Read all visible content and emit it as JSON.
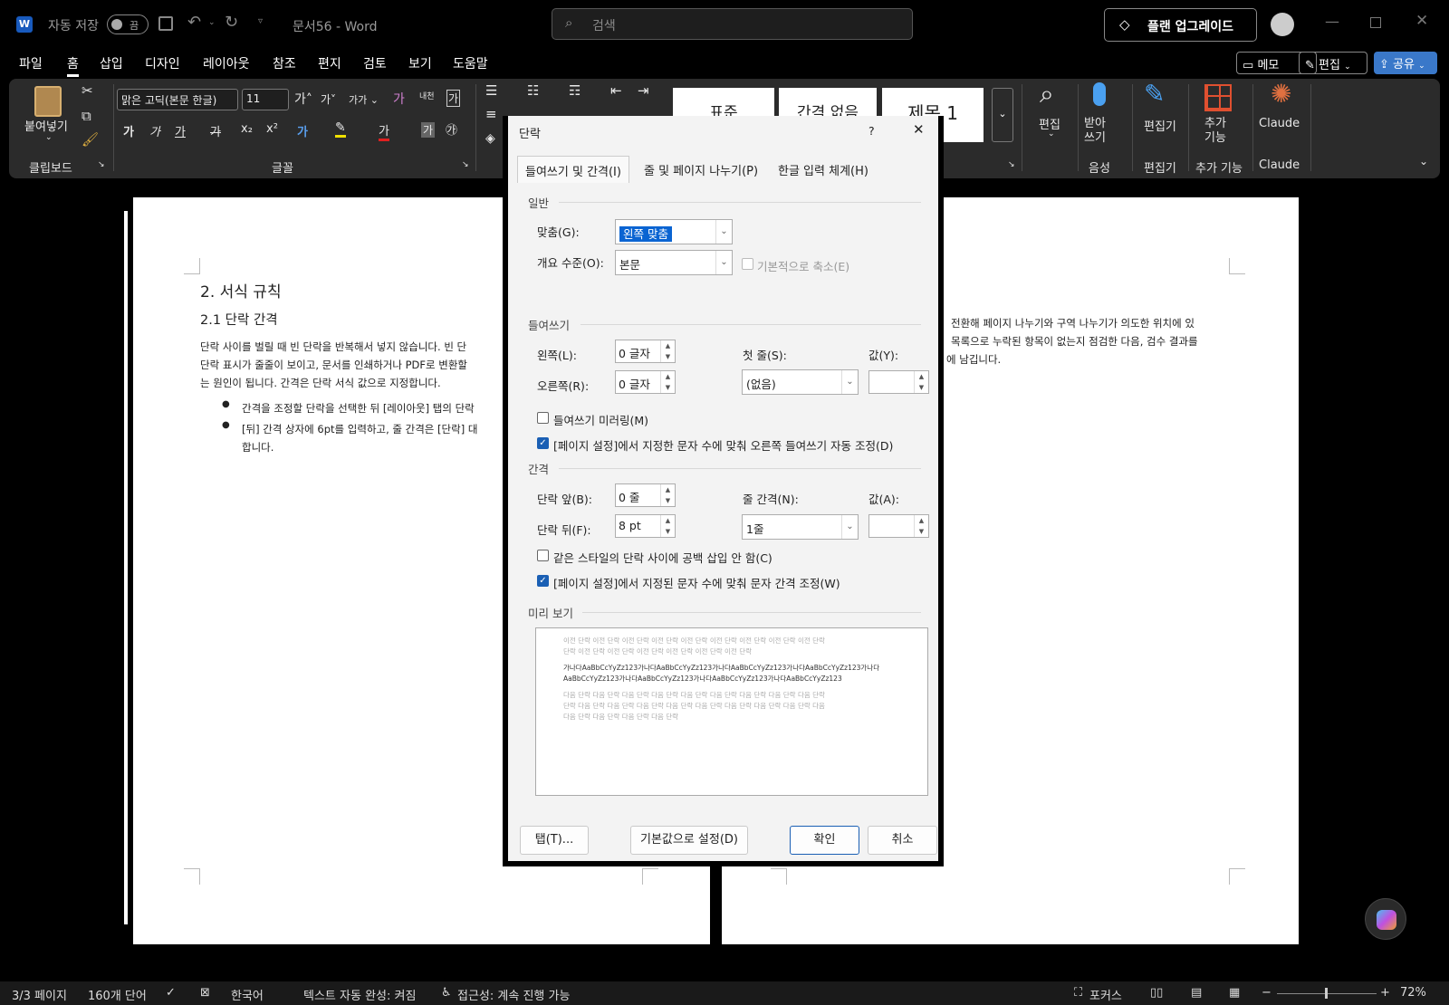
{
  "titlebar": {
    "autosave_label": "자동 저장",
    "autosave_state": "끔",
    "doc_title": "문서56 - Word",
    "search_placeholder": "검색",
    "upgrade_label": "플랜 업그레이드"
  },
  "tabs": [
    "파일",
    "홈",
    "삽입",
    "디자인",
    "레이아웃",
    "참조",
    "편지",
    "검토",
    "보기",
    "도움말"
  ],
  "right_buttons": {
    "memo": "메모",
    "edit": "편집",
    "share": "공유"
  },
  "ribbon": {
    "paste": "붙여넣기",
    "clipboard": "클립보드",
    "font_name": "맑은 고딕(본문 한글)",
    "font_size": "11",
    "font_group": "글꼴",
    "styles": [
      "표준",
      "간격 없음",
      "제목 1"
    ],
    "edit": "편집",
    "dictate": "받아\n쓰기",
    "voice": "음성",
    "editor": "편집기",
    "editor_group": "편집기",
    "addins": "추가\n기능",
    "addins_group": "추가 기능",
    "claude": "Claude",
    "claude_group": "Claude",
    "font_buttons": [
      "가",
      "가",
      "가",
      "가",
      "x₂",
      "x²",
      "가",
      "가"
    ]
  },
  "doc": {
    "h2": "2. 서식 규칙",
    "h3": "2.1 단락 간격",
    "para1": "단락 사이를 벌릴 때 빈 단락을 반복해서 넣지 않습니다. 빈 단",
    "para2": "단락 표시가 줄줄이 보이고, 문서를 인쇄하거나 PDF로 변환할",
    "para3": "는 원인이 됩니다. 간격은 단락 서식 값으로 지정합니다.",
    "bullet1": "간격을 조정할 단락을 선택한 뒤 [레이아웃] 탭의 단락",
    "bullet2a": "[뒤] 간격 상자에 6pt를 입력하고, 줄 간격은 [단락] 대",
    "bullet2b": "합니다.",
    "right1": "전환해 페이지 나누기와 구역 나누기가 의도한 위치에 있",
    "right2": "목록으로 누락된 항목이 없는지 점검한 다음, 검수 결과를",
    "right3": "에 남깁니다."
  },
  "dialog": {
    "title": "단락",
    "help": "?",
    "tabs": [
      "들여쓰기 및 간격(I)",
      "줄 및 페이지 나누기(P)",
      "한글 입력 체계(H)"
    ],
    "general": "일반",
    "align_label": "맞춤(G):",
    "align_value": "왼쪽 맞춤",
    "outline_label": "개요 수준(O):",
    "outline_value": "본문",
    "collapse_label": "기본적으로 축소(E)",
    "indent": "들여쓰기",
    "left_label": "왼쪽(L):",
    "left_value": "0 글자",
    "right_label": "오른쪽(R):",
    "right_value": "0 글자",
    "first_label": "첫 줄(S):",
    "first_value": "(없음)",
    "val_label": "값(Y):",
    "mirror_label": "들여쓰기 미러링(M)",
    "auto_right_label": "[페이지 설정]에서 지정한 문자 수에 맞춰 오른쪽 들여쓰기 자동 조정(D)",
    "spacing": "간격",
    "before_label": "단락 앞(B):",
    "before_value": "0 줄",
    "after_label": "단락 뒤(F):",
    "after_value": "8 pt",
    "line_label": "줄 간격(N):",
    "line_value": "1줄",
    "at_label": "값(A):",
    "nospace_label": "같은 스타일의 단락 사이에 공백 삽입 안 함(C)",
    "grid_label": "[페이지 설정]에서 지정된 문자 수에 맞춰 문자 간격 조정(W)",
    "preview": "미리 보기",
    "prev1": "이전 단락 이전 단락 이전 단락 이전 단락 이전 단락 이전 단락 이전 단락 이전 단락 이전 단락",
    "prev2": "단락 이전 단락 이전 단락 이전 단락 이전 단락 이전 단락 이전 단락",
    "sample1": "가나다AaBbCcYyZz123가나다AaBbCcYyZz123가나다AaBbCcYyZz123가나다AaBbCcYyZz123가나다",
    "sample2": "AaBbCcYyZz123가나다AaBbCcYyZz123가나다AaBbCcYyZz123가나다AaBbCcYyZz123",
    "next1": "다음 단락 다음 단락 다음 단락 다음 단락 다음 단락 다음 단락 다음 단락 다음 단락 다음 단락",
    "next2": "단락 다음 단락 다음 단락 다음 단락 다음 단락 다음 단락 다음 단락 다음 단락 다음 단락 다음",
    "next3": "다음 단락 다음 단락 다음 단락 다음 단락",
    "tabs_btn": "탭(T)...",
    "default_btn": "기본값으로 설정(D)",
    "ok_btn": "확인",
    "cancel_btn": "취소"
  },
  "status": {
    "page": "3/3 페이지",
    "words": "160개 단어",
    "lang": "한국어",
    "autocomplete": "텍스트 자동 완성: 켜짐",
    "access": "접근성: 계속 진행 가능",
    "focus": "포커스",
    "zoom": "72%"
  }
}
